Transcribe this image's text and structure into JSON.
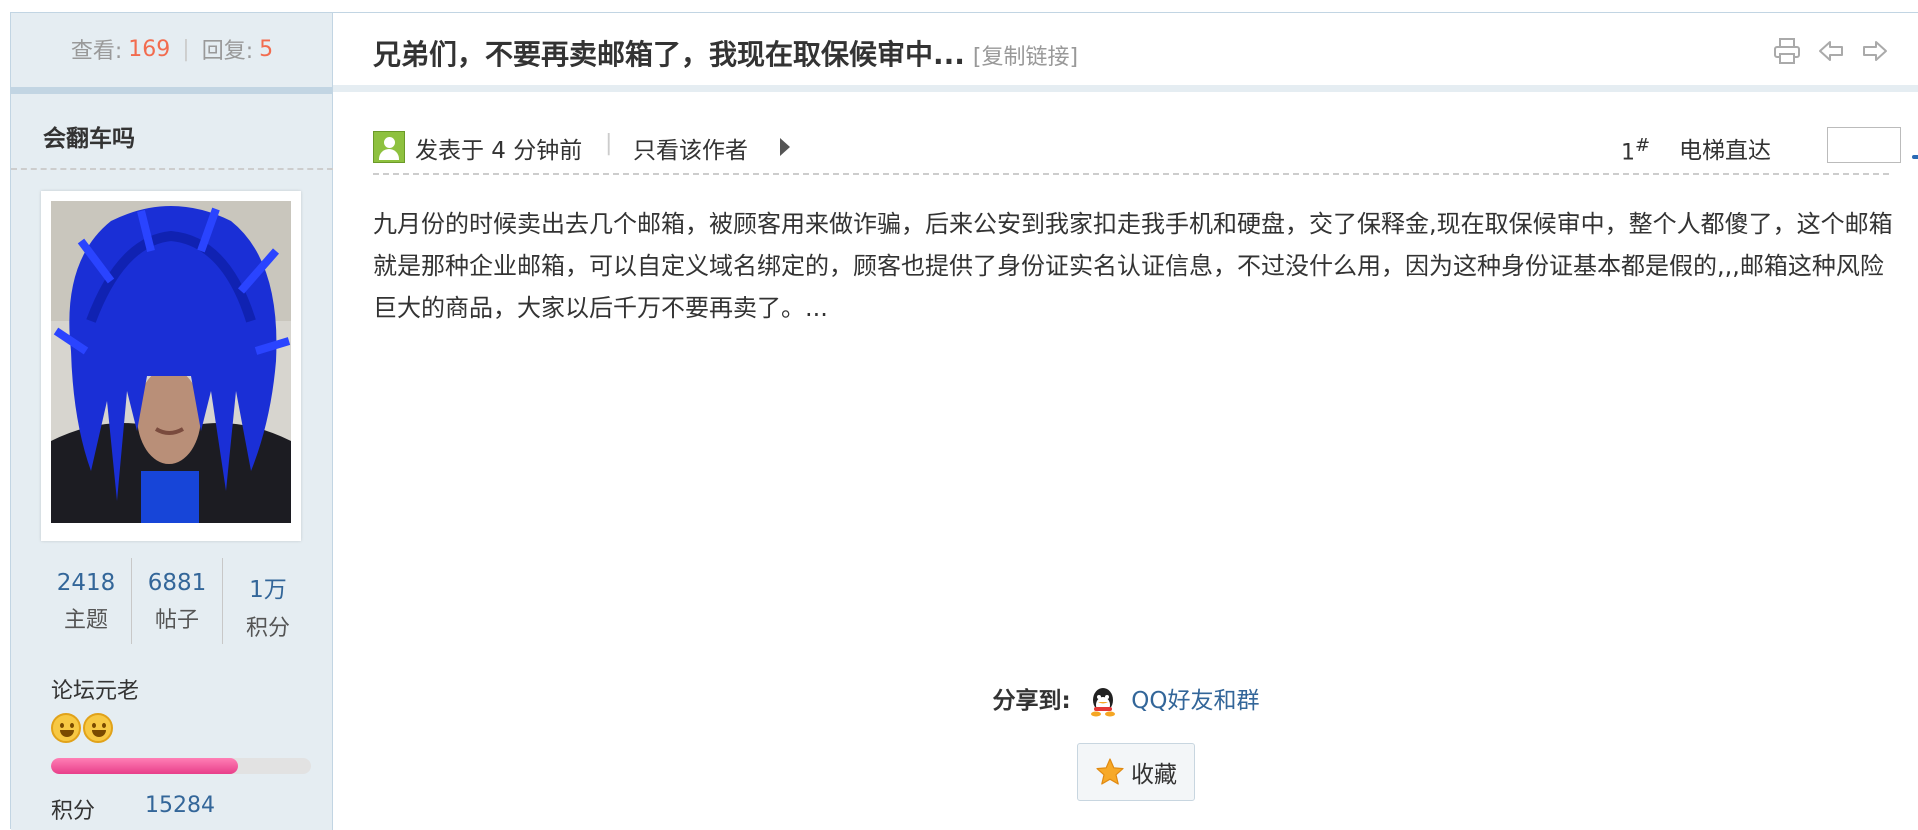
{
  "thread_stats": {
    "views_label": "查看:",
    "views": "169",
    "replies_label": "回复:",
    "replies": "5"
  },
  "post": {
    "title": "兄弟们，不要再卖邮箱了，我现在取保候审中...",
    "copy_link": "[复制链接]",
    "posted_time": "发表于 4 分钟前",
    "only_author": "只看该作者",
    "floor_number": "1",
    "floor_mark": "#",
    "elevator_label": "电梯直达",
    "elevator_input_value": "",
    "body": "九月份的时候卖出去几个邮箱，被顾客用来做诈骗，后来公安到我家扣走我手机和硬盘，交了保释金,现在取保候审中，整个人都傻了，这个邮箱就是那种企业邮箱，可以自定义域名绑定的，顾客也提供了身份证实名认证信息，不过没什么用，因为这种身份证基本都是假的,,,邮箱这种风险巨大的商品，大家以后千万不要再卖了。..."
  },
  "author": {
    "name": "会翻车吗",
    "stats": [
      {
        "value": "2418",
        "label": "主题"
      },
      {
        "value": "6881",
        "label": "帖子"
      },
      {
        "value": "1万",
        "label": "积分"
      }
    ],
    "rank_title": "论坛元老",
    "rank_progress_fraction": 0.72,
    "credits_label": "积分",
    "credits_value": "15284"
  },
  "share": {
    "label": "分享到:",
    "qq_label": "QQ好友和群"
  },
  "favorite": {
    "label": "收藏"
  },
  "icons": {
    "print": "print-icon",
    "prev": "prev-thread-icon",
    "next": "next-thread-icon",
    "elevator": "elevator-go-icon",
    "star": "star-icon",
    "qq": "qq-icon",
    "user": "user-icon"
  },
  "colors": {
    "accent_number": "#f26c4f",
    "link_blue": "#336699",
    "panel_bg": "#e5edf2",
    "border_blue": "#c2d5e3",
    "progress_pink": "#e83f8a"
  }
}
